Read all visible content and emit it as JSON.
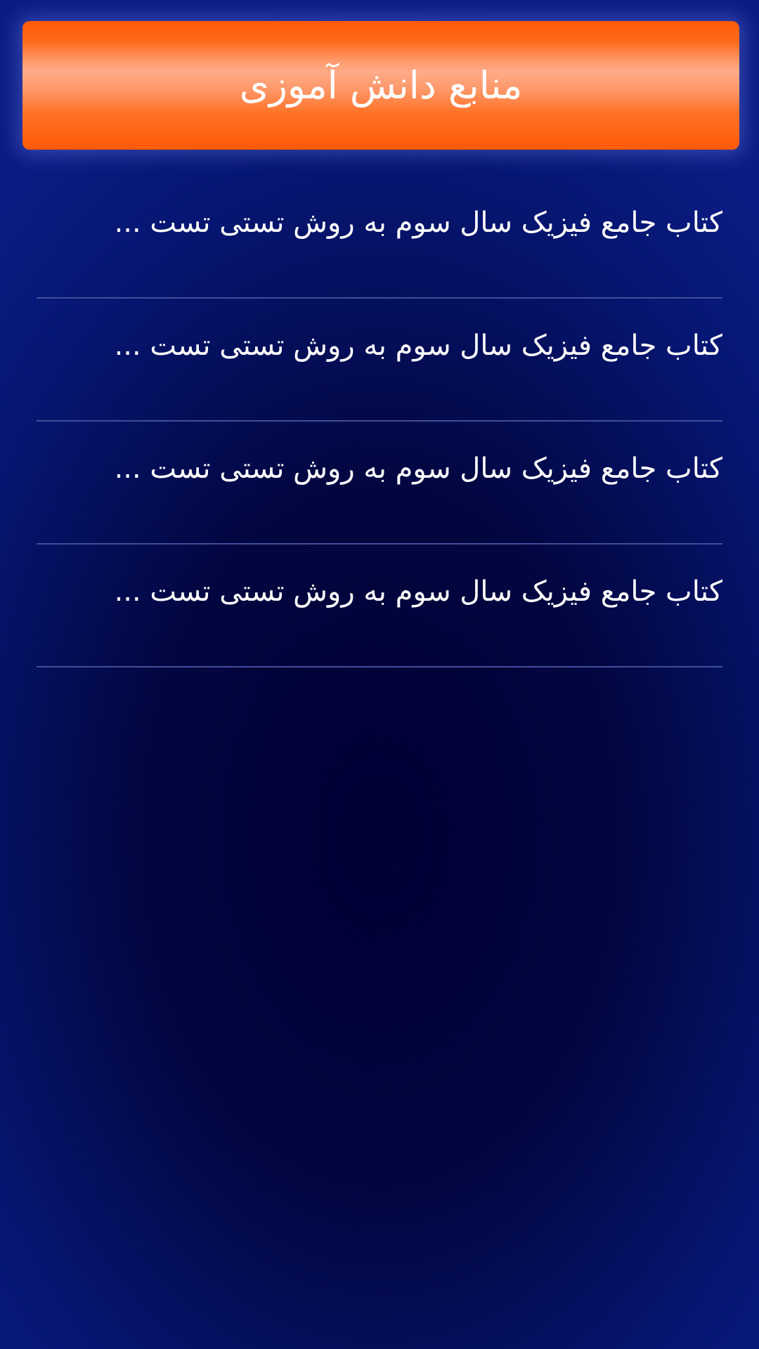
{
  "header": {
    "title": "منابع دانش آموزی"
  },
  "list": {
    "items": [
      {
        "title": "کتاب جامع فیزیک سال سوم به روش تستی تست ..."
      },
      {
        "title": "کتاب جامع فیزیک سال سوم به روش تستی تست ..."
      },
      {
        "title": "کتاب جامع فیزیک سال سوم به روش تستی تست ..."
      },
      {
        "title": "کتاب جامع فیزیک سال سوم به روش تستی تست ..."
      }
    ]
  }
}
